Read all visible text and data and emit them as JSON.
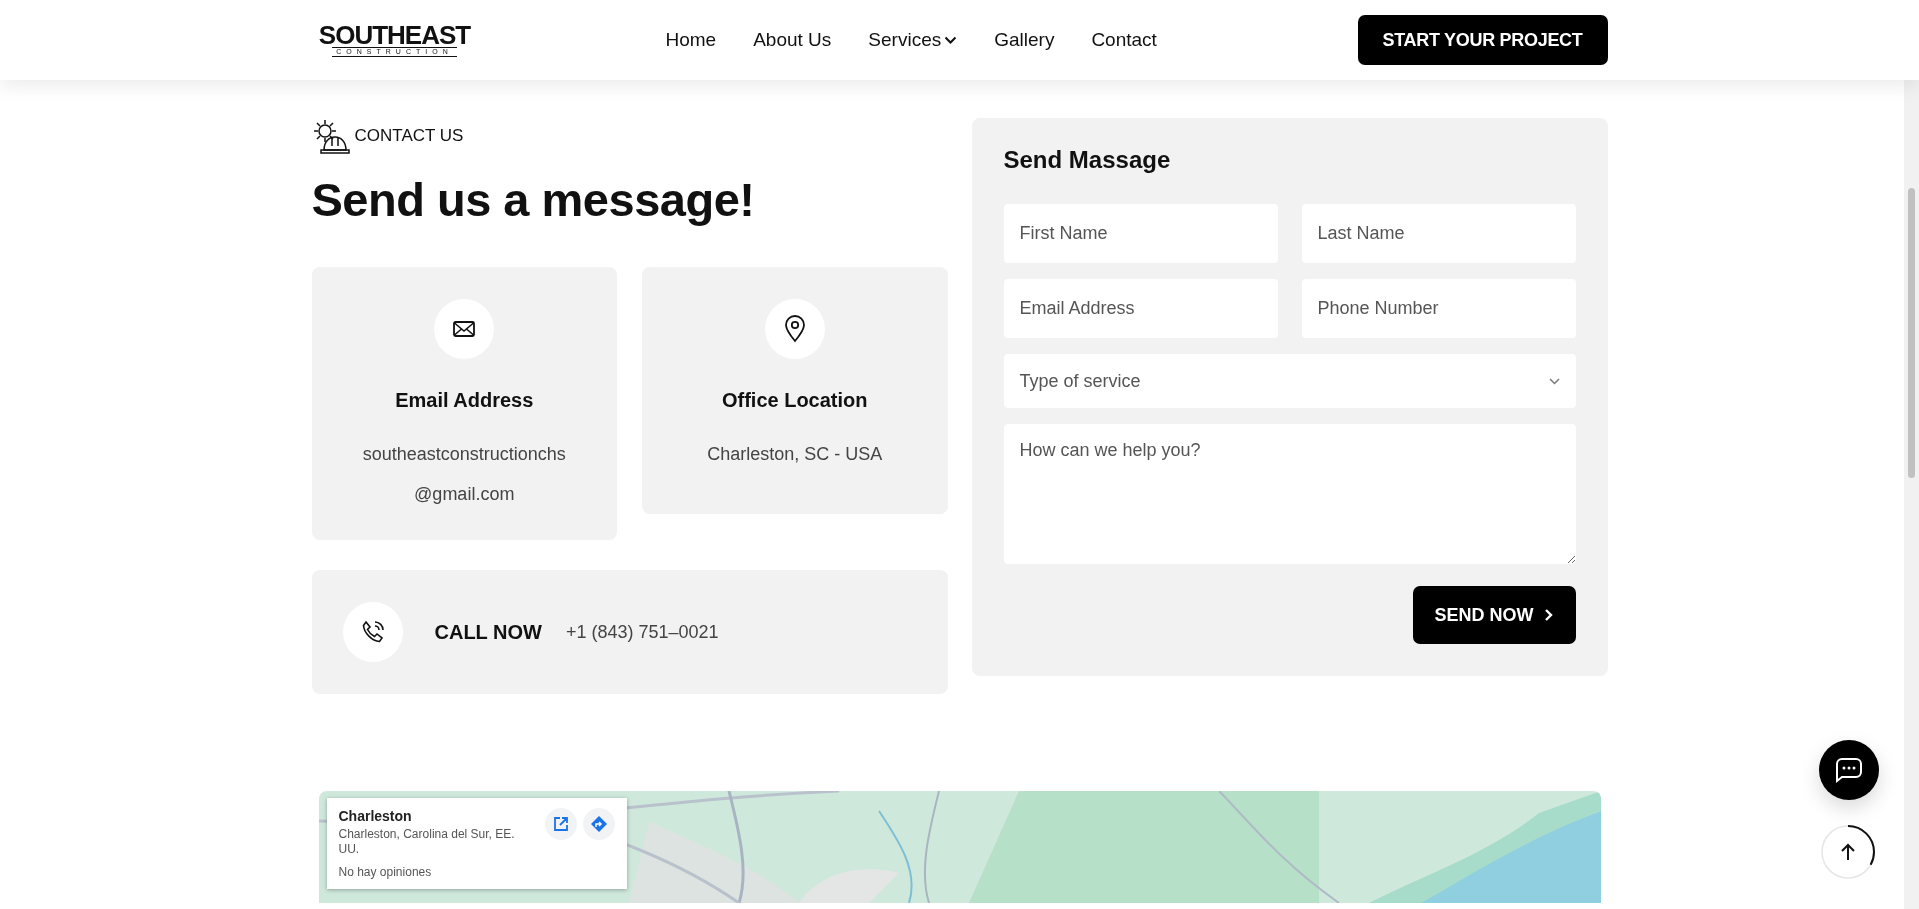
{
  "header": {
    "logo": {
      "name": "SOUTHEAST",
      "tagline": "CONSTRUCTION"
    },
    "nav": [
      {
        "label": "Home",
        "dropdown": false
      },
      {
        "label": "About Us",
        "dropdown": false
      },
      {
        "label": "Services",
        "dropdown": true
      },
      {
        "label": "Gallery",
        "dropdown": false
      },
      {
        "label": "Contact",
        "dropdown": false
      }
    ],
    "cta": "START YOUR PROJECT"
  },
  "contact": {
    "eyebrow": "CONTACT US",
    "heading": "Send us a message!",
    "cards": [
      {
        "kind": "email",
        "title": "Email Address",
        "lines": [
          "southeastconstructionchs",
          "@gmail.com"
        ]
      },
      {
        "kind": "location",
        "title": "Office Location",
        "lines": [
          "Charleston, SC - USA"
        ]
      }
    ],
    "call": {
      "label": "CALL NOW",
      "phone": "+1 (843) 751–0021"
    }
  },
  "form": {
    "title": "Send Massage",
    "fields": [
      {
        "kind": "text",
        "placeholder": "First Name"
      },
      {
        "kind": "text",
        "placeholder": "Last Name"
      },
      {
        "kind": "text",
        "placeholder": "Email Address"
      },
      {
        "kind": "text",
        "placeholder": "Phone Number"
      },
      {
        "kind": "select",
        "placeholder": "Type of service"
      },
      {
        "kind": "textarea",
        "placeholder": "How can we help you?"
      }
    ],
    "submit": "SEND NOW"
  },
  "map": {
    "kind": "picture",
    "place": {
      "name": "Charleston",
      "address": "Charleston, Carolina del Sur, EE. UU.",
      "reviews": "No hay opiniones"
    }
  },
  "back_to_top": {
    "level": 0.33
  }
}
